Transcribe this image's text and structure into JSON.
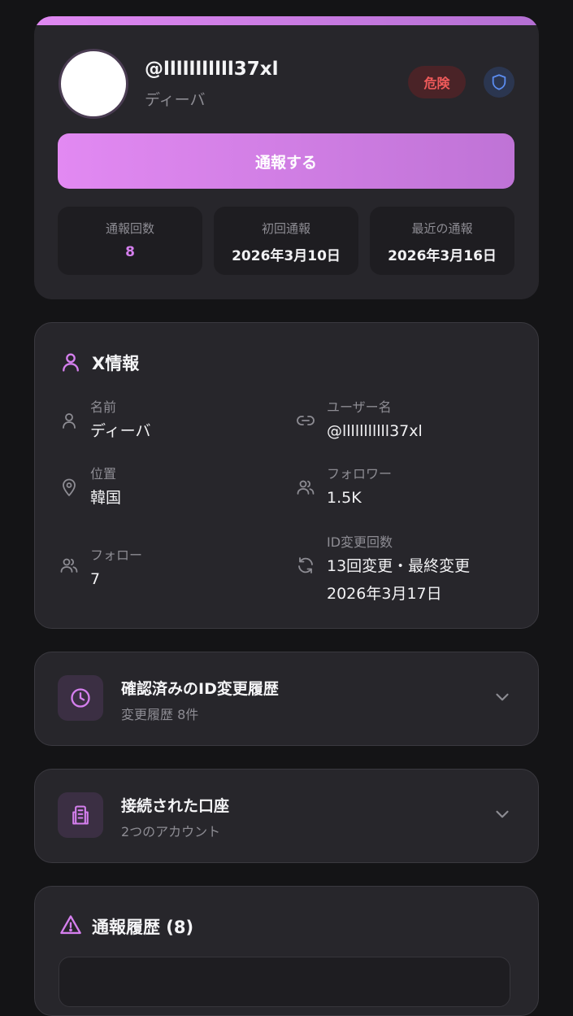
{
  "profile": {
    "handle": "@lllllllllll37xl",
    "display_name": "ディーバ",
    "risk_badge": "危険",
    "report_button": "通報する",
    "stats": [
      {
        "label": "通報回数",
        "value": "8"
      },
      {
        "label": "初回通報",
        "value": "2026年3月10日"
      },
      {
        "label": "最近の通報",
        "value": "2026年3月16日"
      }
    ]
  },
  "x_info": {
    "title": "X情報",
    "fields": {
      "name": {
        "label": "名前",
        "value": "ディーバ"
      },
      "username": {
        "label": "ユーザー名",
        "value": "@lllllllllll37xl"
      },
      "location": {
        "label": "位置",
        "value": "韓国"
      },
      "followers": {
        "label": "フォロワー",
        "value": "1.5K"
      },
      "following": {
        "label": "フォロー",
        "value": "7"
      },
      "id_changes": {
        "label": "ID変更回数",
        "value_line1": "13回変更・最終変更",
        "value_line2": "2026年3月17日"
      }
    }
  },
  "id_history": {
    "title": "確認済みのID変更履歴",
    "subtitle": "変更履歴 8件"
  },
  "accounts": {
    "title": "接続された口座",
    "subtitle": "2つのアカウント"
  },
  "report_history": {
    "title": "通報履歴 (8)"
  },
  "colors": {
    "accent": "#d57fee",
    "danger": "#ef5a5a",
    "card": "#27262b",
    "background": "#141416"
  }
}
